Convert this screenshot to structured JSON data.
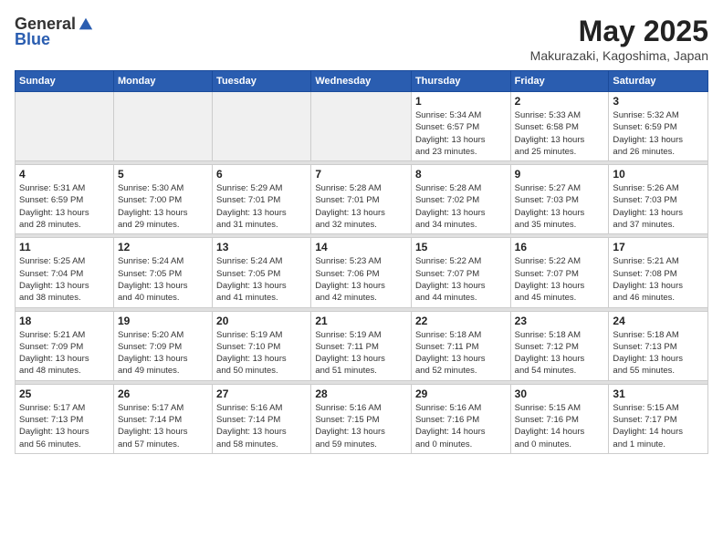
{
  "header": {
    "logo_general": "General",
    "logo_blue": "Blue",
    "title": "May 2025",
    "location": "Makurazaki, Kagoshima, Japan"
  },
  "weekdays": [
    "Sunday",
    "Monday",
    "Tuesday",
    "Wednesday",
    "Thursday",
    "Friday",
    "Saturday"
  ],
  "weeks": [
    [
      {
        "day": "",
        "info": ""
      },
      {
        "day": "",
        "info": ""
      },
      {
        "day": "",
        "info": ""
      },
      {
        "day": "",
        "info": ""
      },
      {
        "day": "1",
        "info": "Sunrise: 5:34 AM\nSunset: 6:57 PM\nDaylight: 13 hours\nand 23 minutes."
      },
      {
        "day": "2",
        "info": "Sunrise: 5:33 AM\nSunset: 6:58 PM\nDaylight: 13 hours\nand 25 minutes."
      },
      {
        "day": "3",
        "info": "Sunrise: 5:32 AM\nSunset: 6:59 PM\nDaylight: 13 hours\nand 26 minutes."
      }
    ],
    [
      {
        "day": "4",
        "info": "Sunrise: 5:31 AM\nSunset: 6:59 PM\nDaylight: 13 hours\nand 28 minutes."
      },
      {
        "day": "5",
        "info": "Sunrise: 5:30 AM\nSunset: 7:00 PM\nDaylight: 13 hours\nand 29 minutes."
      },
      {
        "day": "6",
        "info": "Sunrise: 5:29 AM\nSunset: 7:01 PM\nDaylight: 13 hours\nand 31 minutes."
      },
      {
        "day": "7",
        "info": "Sunrise: 5:28 AM\nSunset: 7:01 PM\nDaylight: 13 hours\nand 32 minutes."
      },
      {
        "day": "8",
        "info": "Sunrise: 5:28 AM\nSunset: 7:02 PM\nDaylight: 13 hours\nand 34 minutes."
      },
      {
        "day": "9",
        "info": "Sunrise: 5:27 AM\nSunset: 7:03 PM\nDaylight: 13 hours\nand 35 minutes."
      },
      {
        "day": "10",
        "info": "Sunrise: 5:26 AM\nSunset: 7:03 PM\nDaylight: 13 hours\nand 37 minutes."
      }
    ],
    [
      {
        "day": "11",
        "info": "Sunrise: 5:25 AM\nSunset: 7:04 PM\nDaylight: 13 hours\nand 38 minutes."
      },
      {
        "day": "12",
        "info": "Sunrise: 5:24 AM\nSunset: 7:05 PM\nDaylight: 13 hours\nand 40 minutes."
      },
      {
        "day": "13",
        "info": "Sunrise: 5:24 AM\nSunset: 7:05 PM\nDaylight: 13 hours\nand 41 minutes."
      },
      {
        "day": "14",
        "info": "Sunrise: 5:23 AM\nSunset: 7:06 PM\nDaylight: 13 hours\nand 42 minutes."
      },
      {
        "day": "15",
        "info": "Sunrise: 5:22 AM\nSunset: 7:07 PM\nDaylight: 13 hours\nand 44 minutes."
      },
      {
        "day": "16",
        "info": "Sunrise: 5:22 AM\nSunset: 7:07 PM\nDaylight: 13 hours\nand 45 minutes."
      },
      {
        "day": "17",
        "info": "Sunrise: 5:21 AM\nSunset: 7:08 PM\nDaylight: 13 hours\nand 46 minutes."
      }
    ],
    [
      {
        "day": "18",
        "info": "Sunrise: 5:21 AM\nSunset: 7:09 PM\nDaylight: 13 hours\nand 48 minutes."
      },
      {
        "day": "19",
        "info": "Sunrise: 5:20 AM\nSunset: 7:09 PM\nDaylight: 13 hours\nand 49 minutes."
      },
      {
        "day": "20",
        "info": "Sunrise: 5:19 AM\nSunset: 7:10 PM\nDaylight: 13 hours\nand 50 minutes."
      },
      {
        "day": "21",
        "info": "Sunrise: 5:19 AM\nSunset: 7:11 PM\nDaylight: 13 hours\nand 51 minutes."
      },
      {
        "day": "22",
        "info": "Sunrise: 5:18 AM\nSunset: 7:11 PM\nDaylight: 13 hours\nand 52 minutes."
      },
      {
        "day": "23",
        "info": "Sunrise: 5:18 AM\nSunset: 7:12 PM\nDaylight: 13 hours\nand 54 minutes."
      },
      {
        "day": "24",
        "info": "Sunrise: 5:18 AM\nSunset: 7:13 PM\nDaylight: 13 hours\nand 55 minutes."
      }
    ],
    [
      {
        "day": "25",
        "info": "Sunrise: 5:17 AM\nSunset: 7:13 PM\nDaylight: 13 hours\nand 56 minutes."
      },
      {
        "day": "26",
        "info": "Sunrise: 5:17 AM\nSunset: 7:14 PM\nDaylight: 13 hours\nand 57 minutes."
      },
      {
        "day": "27",
        "info": "Sunrise: 5:16 AM\nSunset: 7:14 PM\nDaylight: 13 hours\nand 58 minutes."
      },
      {
        "day": "28",
        "info": "Sunrise: 5:16 AM\nSunset: 7:15 PM\nDaylight: 13 hours\nand 59 minutes."
      },
      {
        "day": "29",
        "info": "Sunrise: 5:16 AM\nSunset: 7:16 PM\nDaylight: 14 hours\nand 0 minutes."
      },
      {
        "day": "30",
        "info": "Sunrise: 5:15 AM\nSunset: 7:16 PM\nDaylight: 14 hours\nand 0 minutes."
      },
      {
        "day": "31",
        "info": "Sunrise: 5:15 AM\nSunset: 7:17 PM\nDaylight: 14 hours\nand 1 minute."
      }
    ]
  ]
}
